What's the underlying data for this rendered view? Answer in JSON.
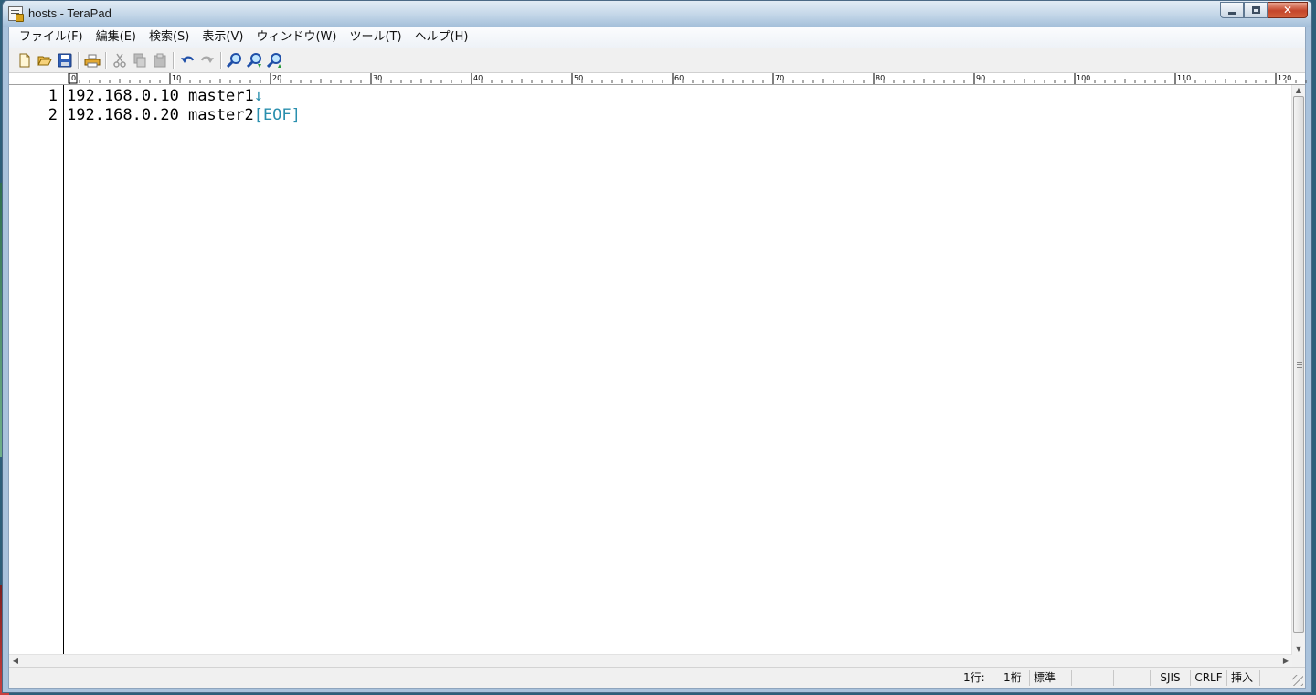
{
  "window": {
    "title": "hosts - TeraPad",
    "buttons": {
      "minimize": "_",
      "maximize": "□",
      "close": "✕"
    }
  },
  "menu": {
    "items": [
      "ファイル(F)",
      "編集(E)",
      "検索(S)",
      "表示(V)",
      "ウィンドウ(W)",
      "ツール(T)",
      "ヘルプ(H)"
    ]
  },
  "toolbar": {
    "icons": [
      "new-file-icon",
      "open-folder-icon",
      "save-icon",
      "print-icon",
      "cut-icon",
      "copy-icon",
      "paste-icon",
      "undo-icon",
      "redo-icon",
      "search-icon",
      "search-next-icon",
      "search-prev-icon"
    ]
  },
  "ruler": {
    "labels": [
      "0",
      "10",
      "20",
      "30",
      "40",
      "50",
      "60",
      "70",
      "80",
      "90",
      "100",
      "110",
      "120"
    ]
  },
  "editor": {
    "lines": [
      {
        "number": "1",
        "text": "192.168.0.10 master1",
        "eol": "↓"
      },
      {
        "number": "2",
        "text": "192.168.0.20 master2",
        "eol": "[EOF]"
      }
    ]
  },
  "status": {
    "row": "1行:",
    "col": "1桁",
    "mode": "標準",
    "encoding": "SJIS",
    "newline": "CRLF",
    "insert": "挿入"
  },
  "colors": {
    "eol_marker": "#2a8fae",
    "gutter_border": "#000000",
    "title_bar": "#bcd3e8",
    "close_button": "#c4452a"
  }
}
